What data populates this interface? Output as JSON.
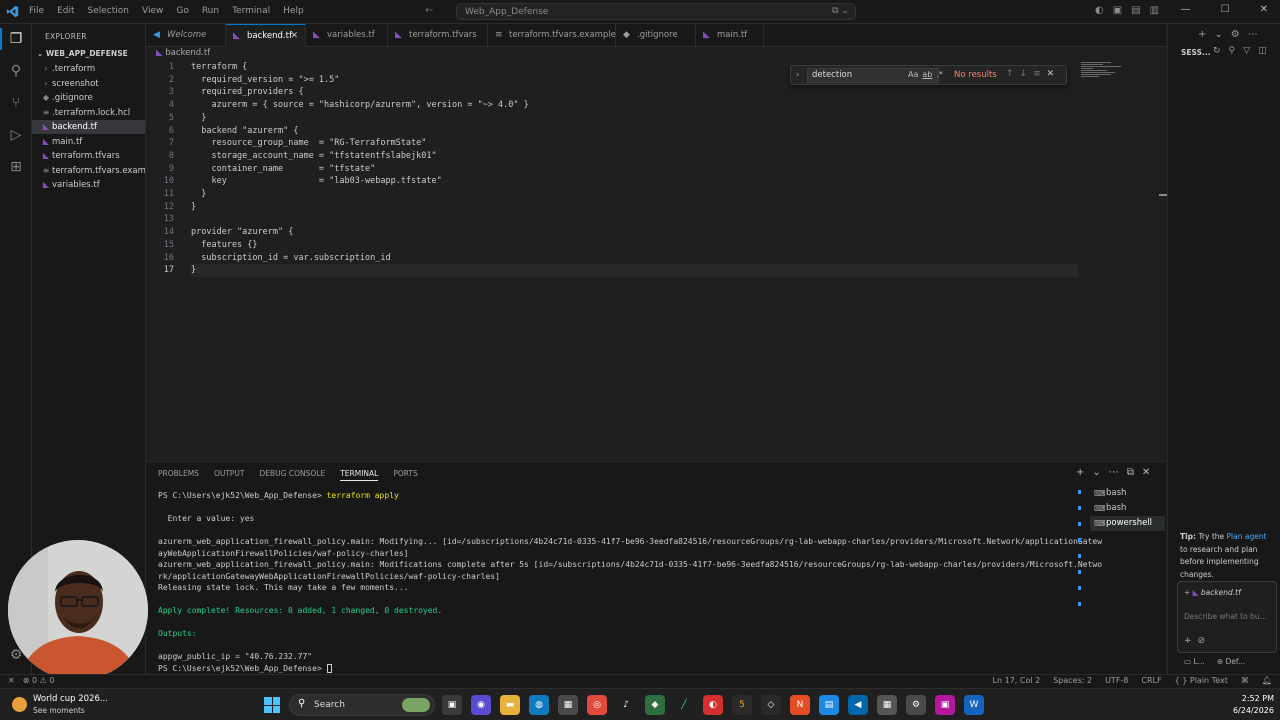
{
  "window": {
    "title": "Web_App_Defense",
    "menu": [
      "File",
      "Edit",
      "Selection",
      "View",
      "Go",
      "Run",
      "Terminal",
      "Help"
    ]
  },
  "explorer": {
    "title": "EXPLORER",
    "root": "WEB_APP_DEFENSE",
    "items": [
      {
        "label": ".terraform",
        "icon": "folder-chevron"
      },
      {
        "label": "screenshot",
        "icon": "folder-chevron"
      },
      {
        "label": ".gitignore",
        "icon": "git-file-icon"
      },
      {
        "label": ".terraform.lock.hcl",
        "icon": "lock-file-icon"
      },
      {
        "label": "backend.tf",
        "icon": "terraform-icon"
      },
      {
        "label": "main.tf",
        "icon": "terraform-icon"
      },
      {
        "label": "terraform.tfvars",
        "icon": "terraform-icon"
      },
      {
        "label": "terraform.tfvars.examp...",
        "icon": "text-file-icon"
      },
      {
        "label": "variables.tf",
        "icon": "terraform-icon"
      }
    ]
  },
  "tabs": [
    {
      "label": "Welcome"
    },
    {
      "label": "backend.tf"
    },
    {
      "label": "variables.tf"
    },
    {
      "label": "terraform.tfvars"
    },
    {
      "label": "terraform.tfvars.example"
    },
    {
      "label": ".gitignore"
    },
    {
      "label": "main.tf"
    }
  ],
  "breadcrumb": "backend.tf",
  "editor": {
    "lines": [
      "terraform {",
      "  required_version = \">= 1.5\"",
      "  required_providers {",
      "    azurerm = { source = \"hashicorp/azurerm\", version = \"~> 4.0\" }",
      "  }",
      "  backend \"azurerm\" {",
      "    resource_group_name  = \"RG-TerraformState\"",
      "    storage_account_name = \"tfstatentfslabejk01\"",
      "    container_name       = \"tfstate\"",
      "    key                  = \"lab03-webapp.tfstate\"",
      "  }",
      "}",
      "",
      "provider \"azurerm\" {",
      "  features {}",
      "  subscription_id = var.subscription_id",
      "}"
    ]
  },
  "find": {
    "value": "detection",
    "result": "No results",
    "opts": [
      "Aa",
      "ab",
      ".*"
    ]
  },
  "panel": {
    "tabs": [
      "PROBLEMS",
      "OUTPUT",
      "DEBUG CONSOLE",
      "TERMINAL",
      "PORTS"
    ],
    "terminal": {
      "prompt1": "PS C:\\Users\\ejk52\\Web_App_Defense> ",
      "cmd1": "terraform apply",
      "enter": "  Enter a value: yes",
      "l1": "azurerm_web_application_firewall_policy.main: Modifying... [id=/subscriptions/4b24c71d-0335-41f7-be96-3eedfa824516/resourceGroups/rg-lab-webapp-charles/providers/Microsoft.Network/applicationGatew",
      "l2": "ayWebApplicationFirewallPolicies/waf-policy-charles]",
      "l3": "azurerm_web_application_firewall_policy.main: Modifications complete after 5s [id=/subscriptions/4b24c71d-0335-41f7-be96-3eedfa824516/resourceGroups/rg-lab-webapp-charles/providers/Microsoft.Netwo",
      "l4": "rk/applicationGatewayWebApplicationFirewallPolicies/waf-policy-charles]",
      "l5": "Releasing state lock. This may take a few moments...",
      "apply": "Apply complete! Resources: 0 added, 1 changed, 0 destroyed.",
      "outputs": "Outputs:",
      "ip": "appgw_public_ip = \"40.76.232.77\"",
      "prompt2": "PS C:\\Users\\ejk52\\Web_App_Defense> "
    },
    "terminals": [
      "bash",
      "bash",
      "powershell"
    ]
  },
  "chat": {
    "title": "SESS...",
    "tip_bold": "Tip:",
    "tip_pre": " Try the ",
    "tip_link": "Plan agent",
    "tip_post": " to research and plan before implementing changes.",
    "chip": "backend.tf",
    "placeholder": "Describe what to bu...",
    "bottom_left": "L...",
    "bottom_right": "Def..."
  },
  "status": {
    "errors": "0",
    "warnings": "0",
    "position": "Ln 17, Col 2",
    "spaces": "Spaces: 2",
    "encoding": "UTF-8",
    "eol": "CRLF",
    "language": "Plain Text"
  },
  "taskbar": {
    "weather_title": "World cup 2026...",
    "weather_sub": "See moments",
    "search": "Search",
    "time": "2:52 PM",
    "date": "6/24/2026"
  },
  "colors": {
    "accent": "#0078d4",
    "terraform": "#844fba",
    "success": "#23d18b",
    "command": "#e5e510",
    "no_results": "#f48771"
  }
}
